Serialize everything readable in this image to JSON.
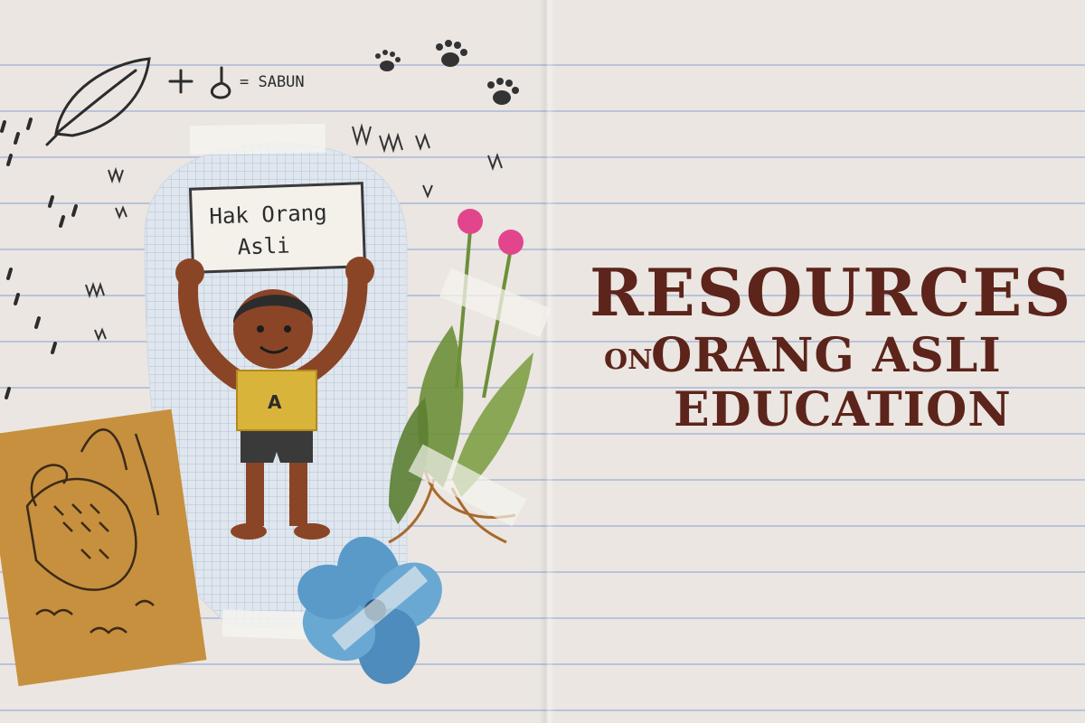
{
  "title": {
    "line1": "RESOURCES",
    "on": "ON",
    "line2": "ORANG ASLI",
    "line3": "EDUCATION"
  },
  "illustration": {
    "sign_line1": "Hak Orang",
    "sign_line2": "Asli",
    "shirt_letter": "A",
    "equation_equals": "= SABUN"
  },
  "colors": {
    "title": "#5c241a",
    "paper": "#ebe6e2",
    "rule_line": "#b9c3da",
    "kraft_card": "#c7903e",
    "skin": "#8a4526",
    "shirt": "#d9b43a",
    "flower_blue": "#5a9ac8",
    "flower_pink": "#e2458c"
  },
  "icons": [
    "leaf-icon",
    "paw-print-icon",
    "water-drop-icon",
    "fern-plant-icon",
    "blue-flower-icon",
    "pangolin-drawing-icon",
    "tape-strip-icon"
  ]
}
